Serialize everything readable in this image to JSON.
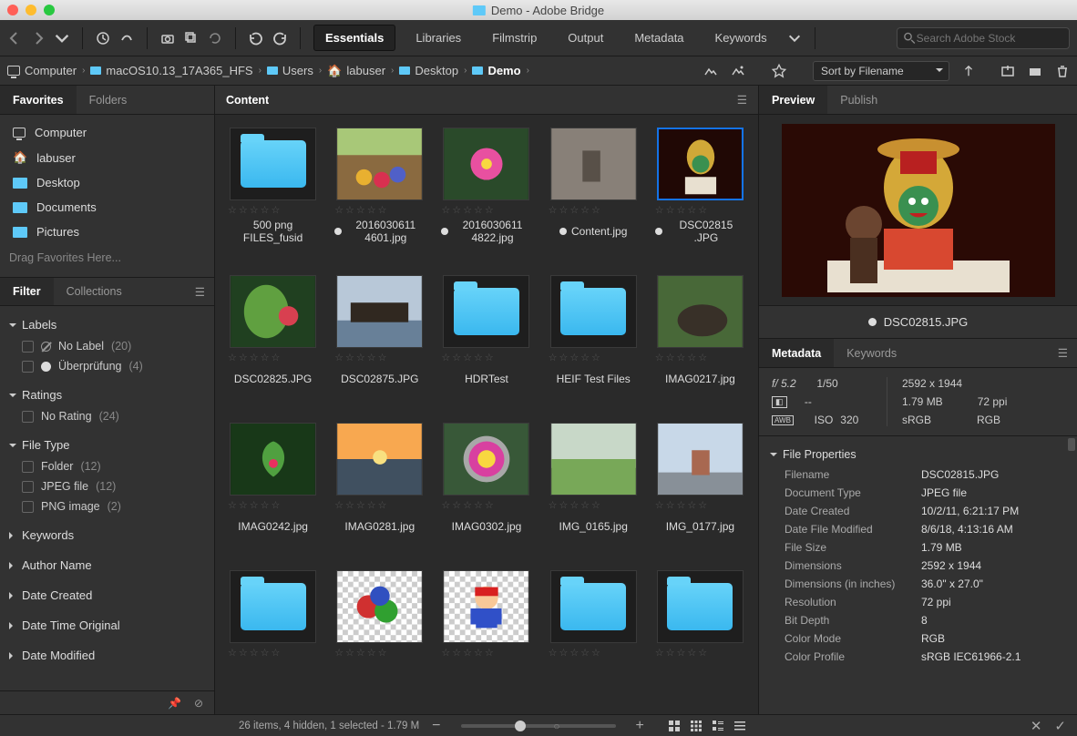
{
  "window": {
    "title": "Demo - Adobe Bridge"
  },
  "workspaces": [
    "Essentials",
    "Libraries",
    "Filmstrip",
    "Output",
    "Metadata",
    "Keywords"
  ],
  "workspace_active": 0,
  "search_placeholder": "Search Adobe Stock",
  "breadcrumbs": [
    "Computer",
    "macOS10.13_17A365_HFS",
    "Users",
    "labuser",
    "Desktop",
    "Demo"
  ],
  "sort_label": "Sort by Filename",
  "left": {
    "tabs_top": [
      "Favorites",
      "Folders"
    ],
    "tabs_top_active": 0,
    "favorites": [
      "Computer",
      "labuser",
      "Desktop",
      "Documents",
      "Pictures"
    ],
    "drag_hint": "Drag Favorites Here...",
    "tabs_bottom": [
      "Filter",
      "Collections"
    ],
    "tabs_bottom_active": 0,
    "filter": {
      "sections": [
        {
          "name": "Labels",
          "open": true,
          "items": [
            {
              "label": "No Label",
              "count": "(20)",
              "icon": "nolabel"
            },
            {
              "label": "Überprüfung",
              "count": "(4)",
              "icon": "white"
            }
          ]
        },
        {
          "name": "Ratings",
          "open": true,
          "items": [
            {
              "label": "No Rating",
              "count": "(24)"
            }
          ]
        },
        {
          "name": "File Type",
          "open": true,
          "items": [
            {
              "label": "Folder",
              "count": "(12)"
            },
            {
              "label": "JPEG file",
              "count": "(12)"
            },
            {
              "label": "PNG image",
              "count": "(2)"
            }
          ]
        },
        {
          "name": "Keywords",
          "open": false
        },
        {
          "name": "Author Name",
          "open": false
        },
        {
          "name": "Date Created",
          "open": false
        },
        {
          "name": "Date Time Original",
          "open": false
        },
        {
          "name": "Date Modified",
          "open": false
        }
      ]
    }
  },
  "content": {
    "title": "Content",
    "items": [
      {
        "name": "500 png FILES_fusid",
        "type": "folder"
      },
      {
        "name": "2016030611 4601.jpg",
        "type": "jpg",
        "dot": true,
        "img": "garden"
      },
      {
        "name": "2016030611 4822.jpg",
        "type": "jpg",
        "dot": true,
        "img": "flower"
      },
      {
        "name": "Content.jpg",
        "type": "jpg",
        "dot": true,
        "img": "wall"
      },
      {
        "name": "DSC02815 .JPG",
        "type": "jpg",
        "dot": true,
        "img": "kathakali",
        "selected": true
      },
      {
        "name": "DSC02825.JPG",
        "type": "jpg",
        "img": "leaf"
      },
      {
        "name": "DSC02875.JPG",
        "type": "jpg",
        "img": "boat"
      },
      {
        "name": "HDRTest",
        "type": "folder"
      },
      {
        "name": "HEIF Test Files",
        "type": "folder"
      },
      {
        "name": "IMAG0217.jpg",
        "type": "jpg",
        "img": "animal"
      },
      {
        "name": "IMAG0242.jpg",
        "type": "jpg",
        "img": "anthurium"
      },
      {
        "name": "IMAG0281.jpg",
        "type": "jpg",
        "img": "sunset"
      },
      {
        "name": "IMAG0302.jpg",
        "type": "jpg",
        "img": "pookalam"
      },
      {
        "name": "IMG_0165.jpg",
        "type": "jpg",
        "img": "field"
      },
      {
        "name": "IMG_0177.jpg",
        "type": "jpg",
        "img": "temple"
      },
      {
        "name": "",
        "type": "folder"
      },
      {
        "name": "",
        "type": "png",
        "img": "dice"
      },
      {
        "name": "",
        "type": "png",
        "img": "mario"
      },
      {
        "name": "",
        "type": "folder"
      },
      {
        "name": "",
        "type": "folder"
      }
    ]
  },
  "status": "26 items, 4 hidden, 1 selected - 1.79 M",
  "preview": {
    "tabs": [
      "Preview",
      "Publish"
    ],
    "tabs_active": 0,
    "filename": "DSC02815.JPG",
    "meta_tabs": [
      "Metadata",
      "Keywords"
    ],
    "meta_tabs_active": 0,
    "exif": {
      "aperture": "f/ 5.2",
      "shutter": "1/50",
      "exposure": "--",
      "iso_label": "ISO",
      "iso": "320",
      "dimensions": "2592 x 1944",
      "size": "1.79 MB",
      "ppi": "72 ppi",
      "colorspace": "sRGB",
      "mode": "RGB"
    },
    "properties_title": "File Properties",
    "properties": [
      {
        "k": "Filename",
        "v": "DSC02815.JPG"
      },
      {
        "k": "Document Type",
        "v": "JPEG file"
      },
      {
        "k": "Date Created",
        "v": "10/2/11, 6:21:17 PM"
      },
      {
        "k": "Date File Modified",
        "v": "8/6/18, 4:13:16 AM"
      },
      {
        "k": "File Size",
        "v": "1.79 MB"
      },
      {
        "k": "Dimensions",
        "v": "2592 x 1944"
      },
      {
        "k": "Dimensions (in inches)",
        "v": "36.0\" x 27.0\""
      },
      {
        "k": "Resolution",
        "v": "72 ppi"
      },
      {
        "k": "Bit Depth",
        "v": "8"
      },
      {
        "k": "Color Mode",
        "v": "RGB"
      },
      {
        "k": "Color Profile",
        "v": "sRGB IEC61966-2.1"
      }
    ]
  }
}
